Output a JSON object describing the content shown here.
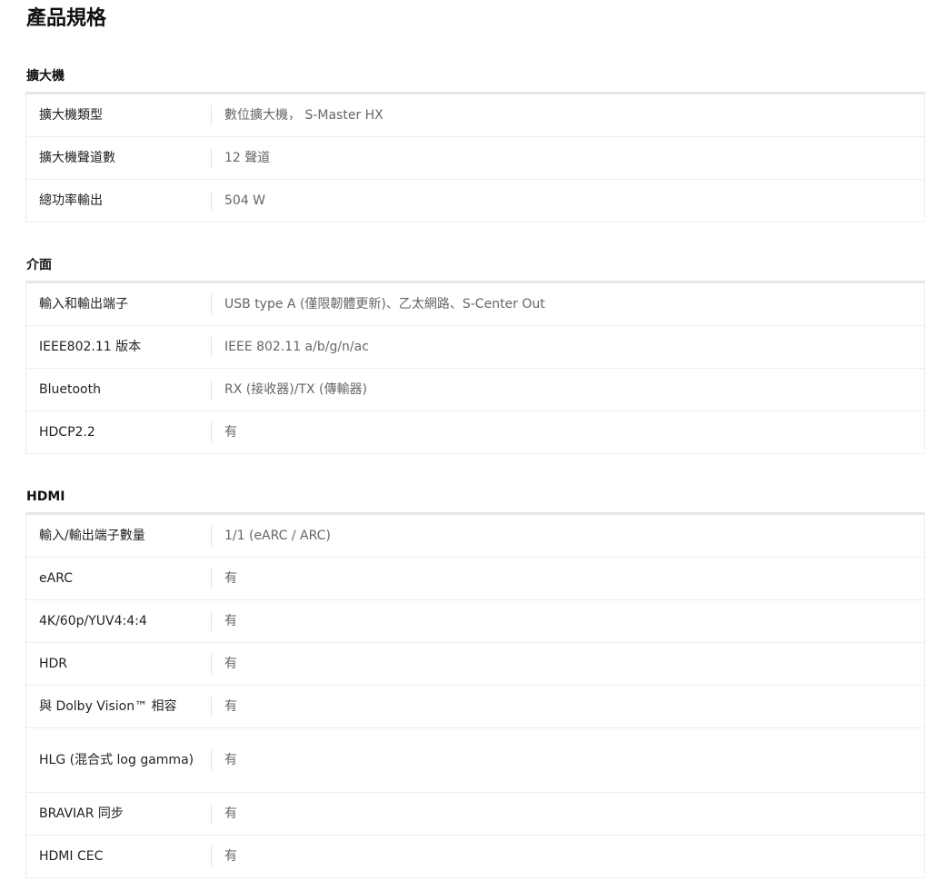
{
  "page": {
    "title": "產品規格"
  },
  "sections": [
    {
      "title": "擴大機",
      "rows": [
        {
          "label": "擴大機類型",
          "value": "數位擴大機， S-Master HX"
        },
        {
          "label": "擴大機聲道數",
          "value": "12 聲道"
        },
        {
          "label": "總功率輸出",
          "value": "504 W"
        }
      ]
    },
    {
      "title": "介面",
      "rows": [
        {
          "label": "輸入和輸出端子",
          "value": "USB type A (僅限韌體更新)、乙太網路、S-Center Out"
        },
        {
          "label": "IEEE802.11 版本",
          "value": "IEEE 802.11 a/b/g/n/ac"
        },
        {
          "label": "Bluetooth",
          "value": "RX (接收器)/TX (傳輸器)"
        },
        {
          "label": "HDCP2.2",
          "value": "有"
        }
      ]
    },
    {
      "title": "HDMI",
      "rows": [
        {
          "label": "輸入/輸出端子數量",
          "value": "1/1 (eARC / ARC)"
        },
        {
          "label": "eARC",
          "value": "有"
        },
        {
          "label": "4K/60p/YUV4:4:4",
          "value": "有"
        },
        {
          "label": "HDR",
          "value": "有"
        },
        {
          "label": "與 Dolby Vision™ 相容",
          "value": "有"
        },
        {
          "label": "HLG (混合式 log gamma)",
          "value": "有"
        },
        {
          "label": "BRAVIAR 同步",
          "value": "有"
        },
        {
          "label": "HDMI CEC",
          "value": "有"
        }
      ]
    }
  ]
}
